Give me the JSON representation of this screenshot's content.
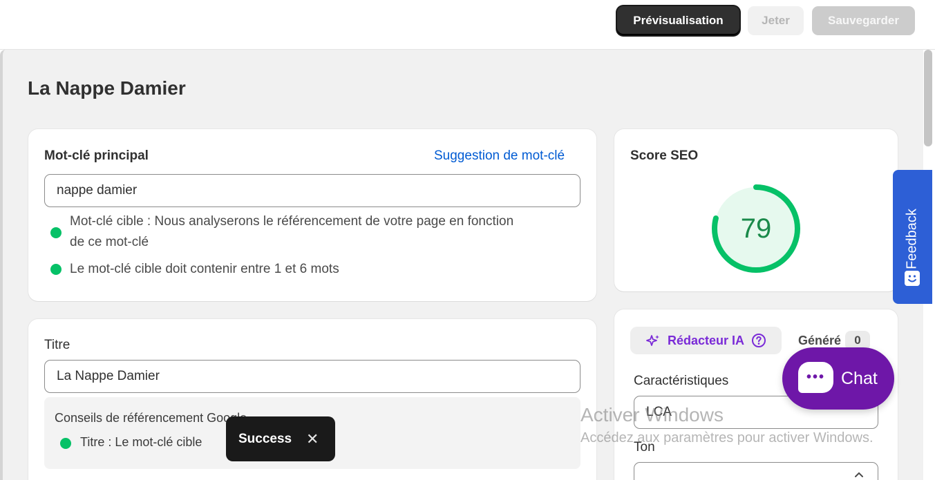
{
  "toolbar": {
    "preview_label": "Prévisualisation",
    "discard_label": "Jeter",
    "save_label": "Sauvegarder"
  },
  "page": {
    "title": "La Nappe Damier"
  },
  "keyword_card": {
    "heading": "Mot-clé principal",
    "suggestion_link": "Suggestion de mot-clé",
    "input_value": "nappe damier",
    "tips": [
      {
        "line1": "Mot-clé cible : Nous analyserons le référencement de votre page en fonction",
        "line2": "de ce mot-clé"
      },
      {
        "line1": "Le mot-clé cible doit contenir entre 1 et 6 mots"
      }
    ]
  },
  "title_card": {
    "label": "Titre",
    "input_value": "La Nappe Damier",
    "advice_heading": "Conseils de référencement Google",
    "advice_item": "Titre : Le mot-clé cible"
  },
  "seo_card": {
    "heading": "Score SEO",
    "score": 79,
    "score_display": "79",
    "color": "#06c167"
  },
  "ai_card": {
    "writer_label": "Rédacteur IA",
    "generated_label": "Généré",
    "generated_count": "0",
    "characteristics_label": "Caractéristiques",
    "characteristics_value": "LCA",
    "tone_label": "Ton"
  },
  "feedback": {
    "label": "Feedback"
  },
  "chat": {
    "label": "Chat"
  },
  "toast": {
    "text": "Success",
    "close": "✕"
  },
  "watermark": {
    "line1": "Activer Windows",
    "line2": "Accédez aux paramètres pour activer Windows."
  },
  "colors": {
    "accent_blue": "#005bd3",
    "success_green": "#06c167",
    "ai_purple": "#7a2ad7",
    "chat_purple": "#6e17a8",
    "feedback_blue": "#2d5fd6"
  }
}
